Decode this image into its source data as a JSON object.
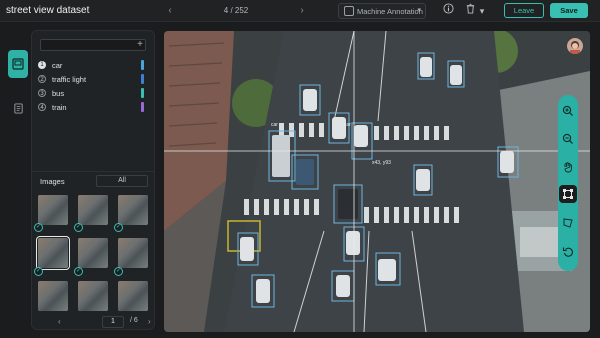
{
  "header": {
    "title": "street view dataset",
    "page_label": "4 / 252",
    "annotation_mode": "Machine Annotation",
    "leave_label": "Leave",
    "save_label": "Save"
  },
  "classes": [
    {
      "index": "1",
      "name": "car",
      "color": "#4aa3d9"
    },
    {
      "index": "2",
      "name": "traffic light",
      "color": "#3d7fd0"
    },
    {
      "index": "3",
      "name": "bus",
      "color": "#39c0b3"
    },
    {
      "index": "4",
      "name": "train",
      "color": "#9b69d6"
    }
  ],
  "images_panel": {
    "label": "Images",
    "filter": "All",
    "current_page": "1",
    "page_sep": "/ 6"
  },
  "canvas": {
    "coord_readout": "x43, y93",
    "box_labels": [
      "car",
      "car"
    ],
    "accent": "#39c0b3"
  }
}
